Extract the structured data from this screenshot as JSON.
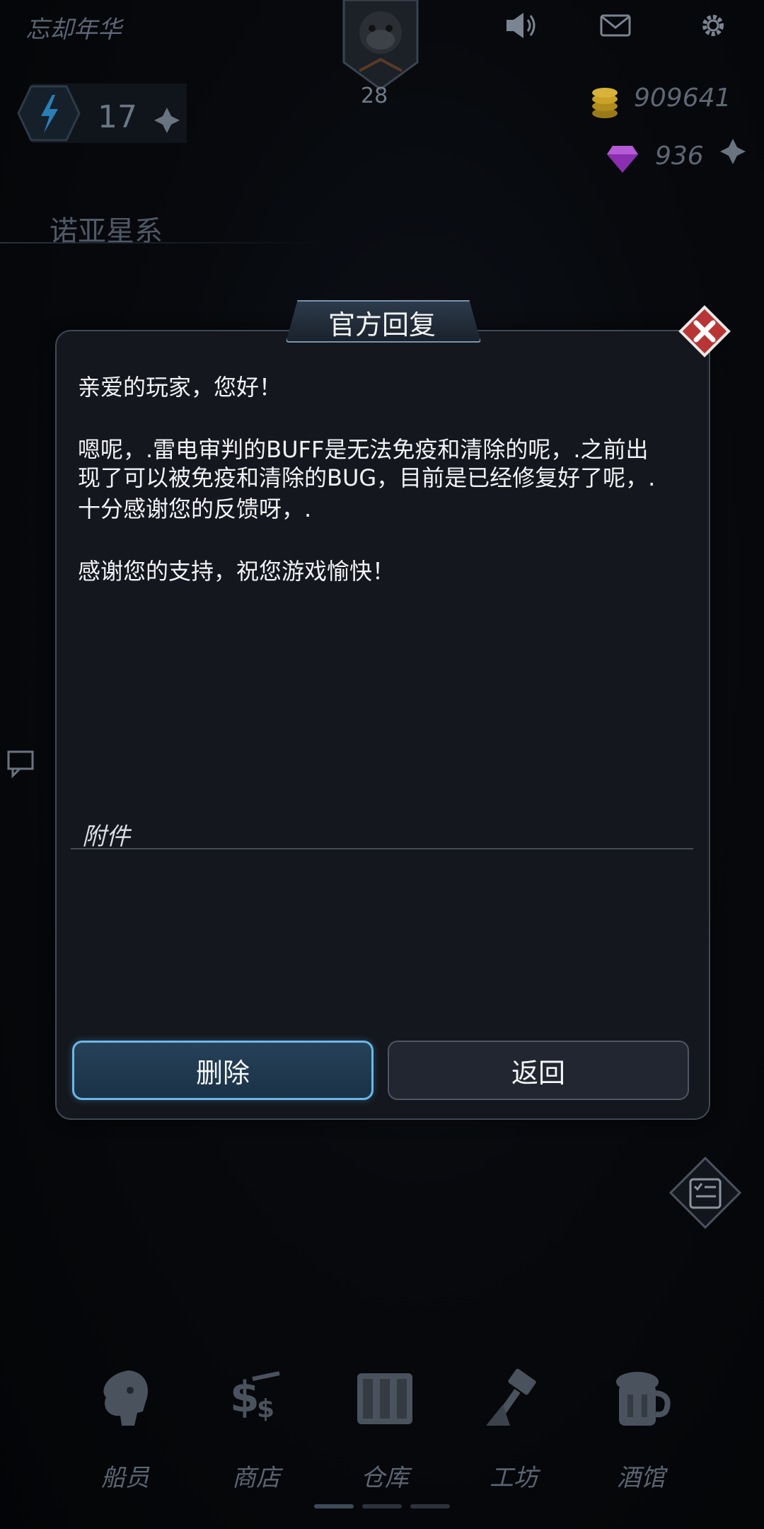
{
  "header": {
    "player_name": "忘却年华",
    "level": "28",
    "energy": "17",
    "gold": "909641",
    "gems": "936",
    "region": "诺亚星系"
  },
  "icons": {
    "sound": "speaker-icon",
    "mail": "mail-icon",
    "settings": "gear-icon"
  },
  "dialog": {
    "title": "官方回复",
    "lines": [
      "亲爱的玩家，您好！",
      "嗯呢，.雷电审判的BUFF是无法免疫和清除的呢，.之前出",
      "现了可以被免疫和清除的BUG，目前是已经修复好了呢，.",
      "十分感谢您的反馈呀，.",
      "感谢您的支持，祝您游戏愉快！"
    ],
    "attachment_label": "附件",
    "delete_label": "删除",
    "back_label": "返回"
  },
  "bottom_nav": [
    {
      "label": "船员",
      "icon": "crew-icon"
    },
    {
      "label": "商店",
      "icon": "shop-icon"
    },
    {
      "label": "仓库",
      "icon": "warehouse-icon"
    },
    {
      "label": "工坊",
      "icon": "workshop-icon"
    },
    {
      "label": "酒馆",
      "icon": "tavern-icon"
    }
  ],
  "colors": {
    "accent_blue": "#6ab8e8",
    "close_red": "#b83535",
    "gold": "#c9a227",
    "gem": "#a63fc4"
  }
}
